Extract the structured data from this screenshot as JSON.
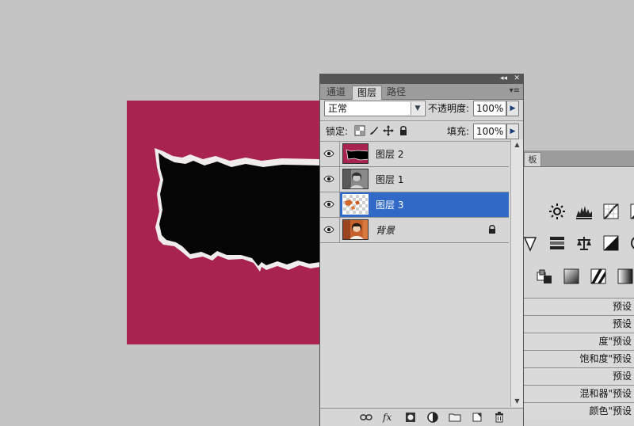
{
  "layers_panel": {
    "tabs": [
      {
        "label": "通道",
        "active": false
      },
      {
        "label": "图层",
        "active": true
      },
      {
        "label": "路径",
        "active": false
      }
    ],
    "title_controls": {
      "collapse": "◂◂",
      "close": "✕"
    },
    "menu_icon": "▾≡",
    "blend_mode": "正常",
    "opacity_label": "不透明度:",
    "opacity_value": "100%",
    "lock_label": "锁定:",
    "fill_label": "填充:",
    "fill_value": "100%",
    "layers": [
      {
        "name": "图层 2",
        "visible": true,
        "selected": false,
        "thumb": "torn-black-mask"
      },
      {
        "name": "图层 1",
        "visible": true,
        "selected": false,
        "thumb": "portrait-grayscale"
      },
      {
        "name": "图层 3",
        "visible": true,
        "selected": true,
        "thumb": "transparent-fragments"
      },
      {
        "name": "背景",
        "visible": true,
        "selected": false,
        "locked": true,
        "thumb": "portrait-color"
      }
    ],
    "bottom_icons": [
      "link-icon",
      "fx-icon",
      "mask-icon",
      "adjustment-icon",
      "folder-icon",
      "new-layer-icon",
      "trash-icon"
    ]
  },
  "adjustments_panel": {
    "tab_fragment": "板",
    "preset_rows": [
      "预设",
      "预设",
      "度\"预设",
      "饱和度\"预设",
      "预设",
      "混和器\"预设",
      "颜色\"预设"
    ]
  },
  "colors": {
    "canvas_bg": "#a8234f",
    "selection": "#3169c6",
    "panel_bg": "#d6d6d6",
    "workspace": "#c4c4c4"
  }
}
